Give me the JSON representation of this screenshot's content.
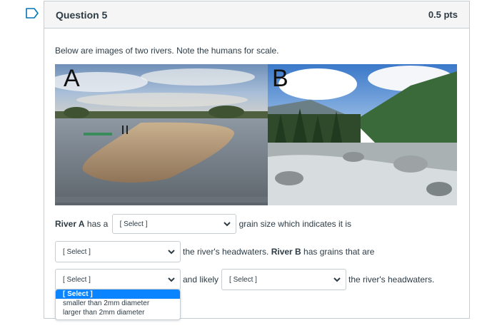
{
  "question": {
    "title": "Question 5",
    "points": "0.5 pts",
    "prompt": "Below are images of two rivers. Note the humans for scale."
  },
  "images": {
    "a_label": "A",
    "b_label": "B"
  },
  "sentence": {
    "river_a": "River A",
    "has_a": " has a ",
    "grain_text": "grain size which indicates it is",
    "headwaters_text": "the river's headwaters. ",
    "river_b": "River B",
    "grains_text": " has grains that are",
    "and_likely": "and likely",
    "headwaters_end": "the river's headwaters."
  },
  "selects": {
    "select1": "[ Select ]",
    "select2": "[ Select ]",
    "select3": "[ Select ]",
    "select4": "[ Select ]"
  },
  "dropdown": {
    "options": [
      "[ Select ]",
      "smaller than 2mm diameter",
      "larger than 2mm diameter"
    ],
    "highlighted_index": 0
  },
  "colors": {
    "flag": "#0374b5",
    "highlight": "#0a84ff"
  }
}
